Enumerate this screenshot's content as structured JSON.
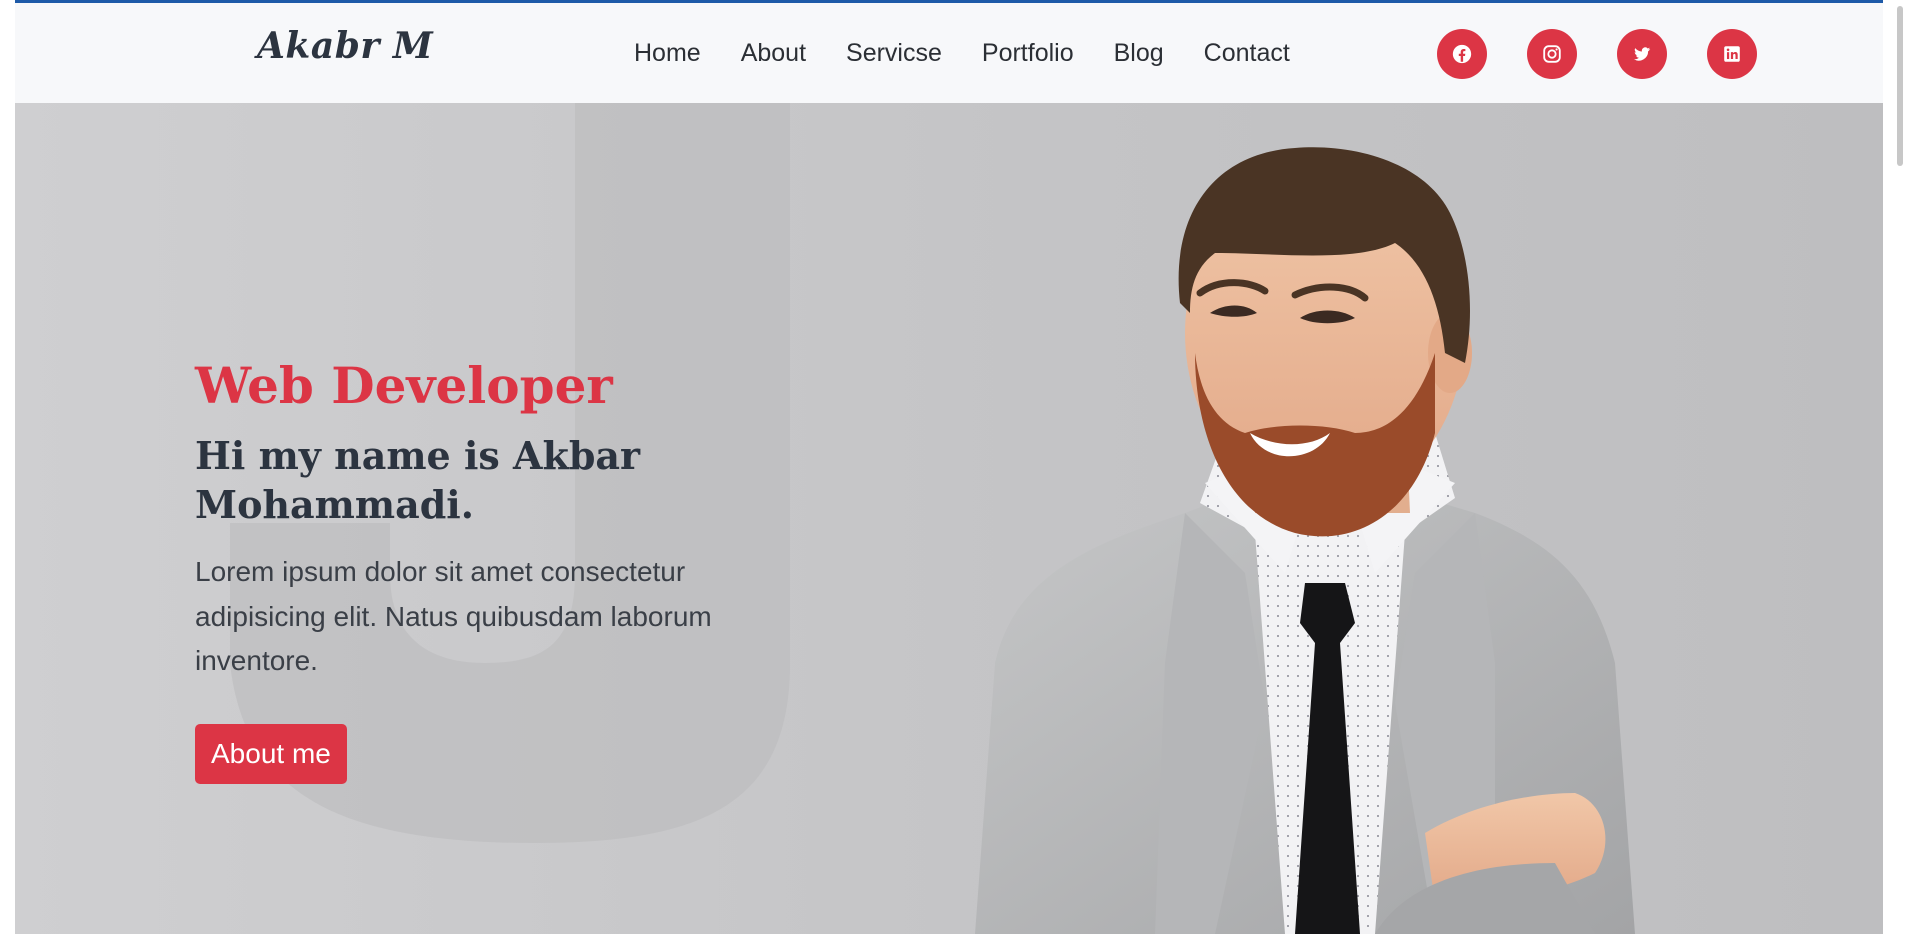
{
  "brand": {
    "logo_text": "Akabr M"
  },
  "nav": {
    "items": [
      {
        "label": "Home"
      },
      {
        "label": "About"
      },
      {
        "label": "Servicse"
      },
      {
        "label": "Portfolio"
      },
      {
        "label": "Blog"
      },
      {
        "label": "Contact"
      }
    ]
  },
  "social": {
    "links": [
      {
        "icon": "facebook-icon"
      },
      {
        "icon": "instagram-icon"
      },
      {
        "icon": "twitter-icon"
      },
      {
        "icon": "linkedin-icon"
      }
    ]
  },
  "hero": {
    "role": "Web Developer",
    "heading": "Hi my name is Akbar Mohammadi.",
    "description": "Lorem ipsum dolor sit amet consectetur adipisicing elit. Natus quibusdam laborum inventore.",
    "button_label": "About me"
  },
  "colors": {
    "accent": "#dc3545",
    "text_dark": "#2c3440",
    "navbar_bg": "#f7f8fa",
    "top_border": "#1e5aa8"
  }
}
